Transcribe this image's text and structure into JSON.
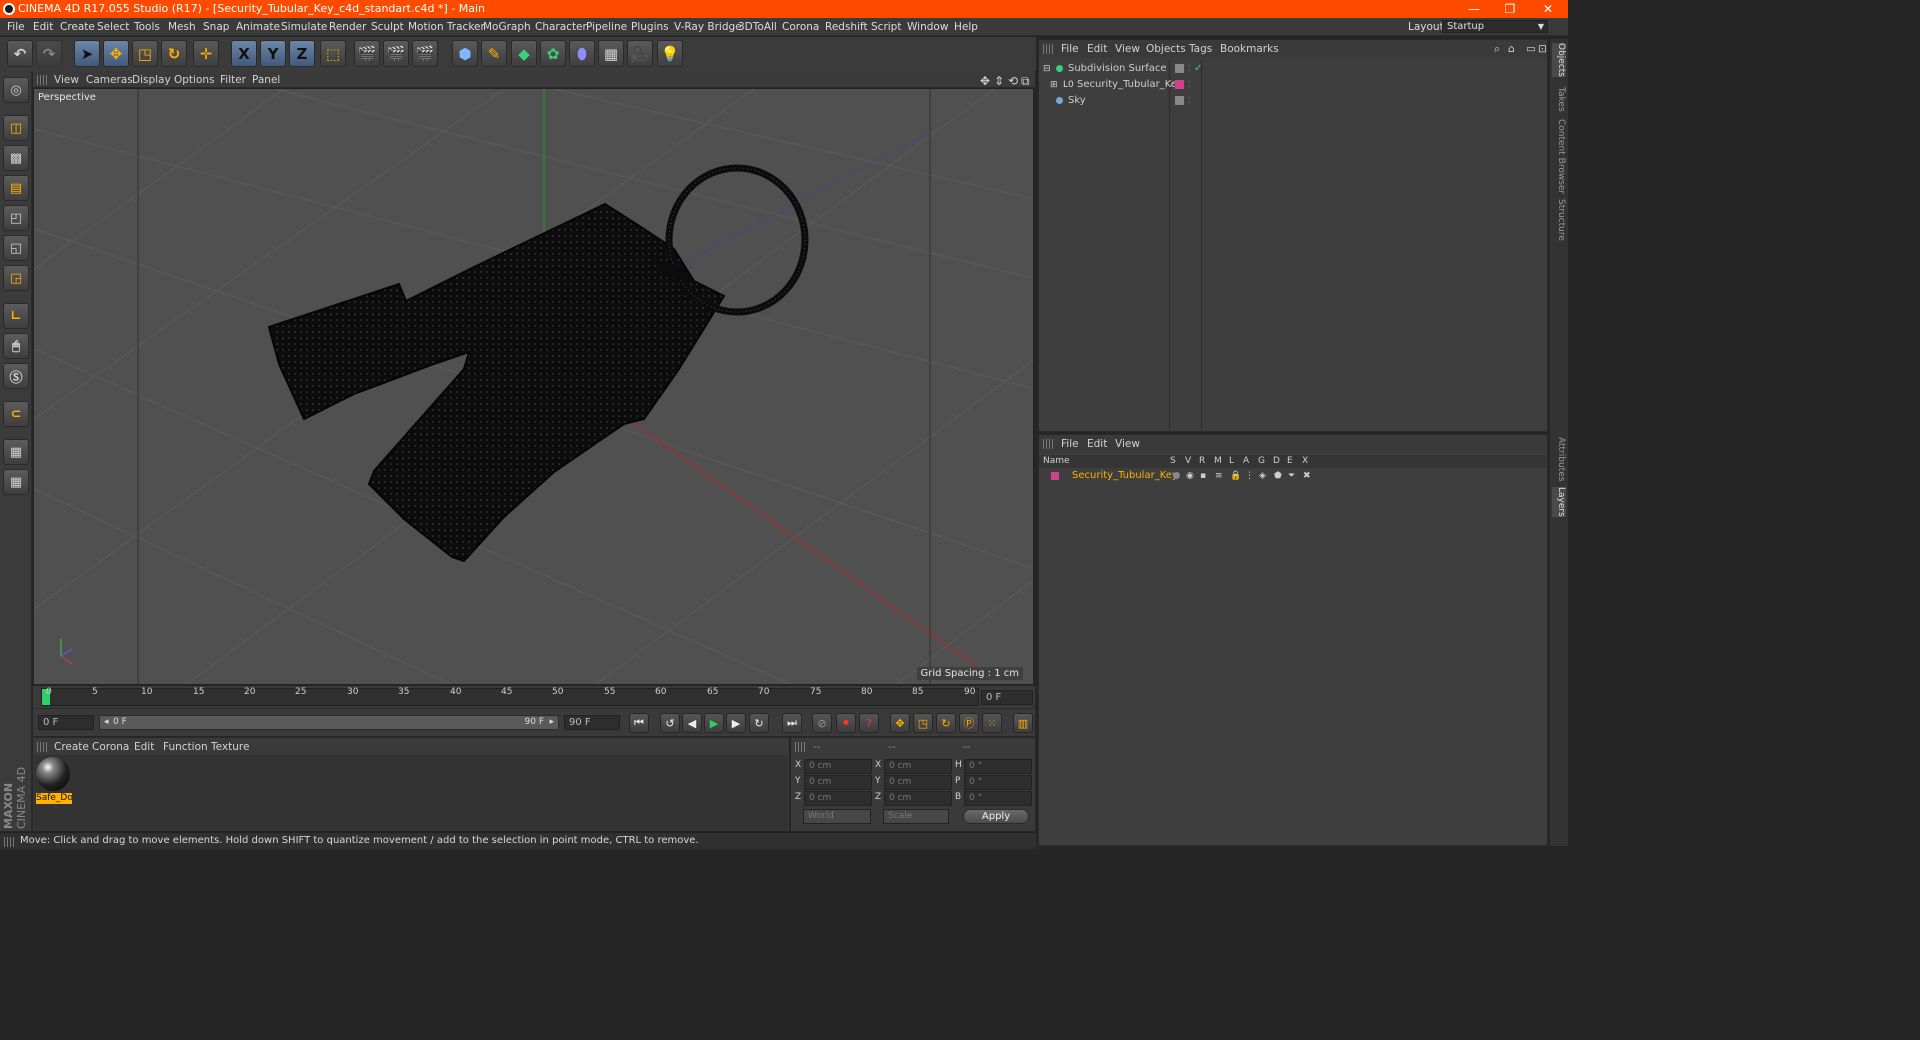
{
  "window": {
    "title": "CINEMA 4D R17.055 Studio (R17) - [Security_Tubular_Key_c4d_standart.c4d *] - Main",
    "minimize": "—",
    "restore": "❐",
    "close": "✕"
  },
  "menubar": {
    "items": [
      "File",
      "Edit",
      "Create",
      "Select",
      "Tools",
      "Mesh",
      "Snap",
      "Animate",
      "Simulate",
      "Render",
      "Sculpt",
      "Motion Tracker",
      "MoGraph",
      "Character",
      "Pipeline",
      "Plugins",
      "V-Ray Bridge",
      "3DToAll",
      "Corona",
      "Redshift",
      "Script",
      "Window",
      "Help"
    ],
    "layout_label": "Layout:",
    "layout_value": "Startup"
  },
  "toolbar": {
    "x_axis": "X",
    "y_axis": "Y",
    "z_axis": "Z"
  },
  "viewport": {
    "menu": [
      "View",
      "Cameras",
      "Display",
      "Options",
      "Filter",
      "Panel"
    ],
    "label": "Perspective",
    "grid_spacing": "Grid Spacing : 1 cm"
  },
  "timeline": {
    "ticks": [
      "0",
      "5",
      "10",
      "15",
      "20",
      "25",
      "30",
      "35",
      "40",
      "45",
      "50",
      "55",
      "60",
      "65",
      "70",
      "75",
      "80",
      "85",
      "90"
    ],
    "current_frame": "0 F"
  },
  "transport": {
    "start": "0 F",
    "range_start": "0 F",
    "range_end": "90 F",
    "end": "90 F"
  },
  "material_manager": {
    "menu": [
      "Create",
      "Corona",
      "Edit",
      "Function",
      "Texture"
    ],
    "material_name": "Safe_Do"
  },
  "coordinates": {
    "header": [
      "--",
      "--",
      "--"
    ],
    "rows": [
      {
        "a": "X",
        "av": "0 cm",
        "b": "X",
        "bv": "0 cm",
        "c": "H",
        "cv": "0 °"
      },
      {
        "a": "Y",
        "av": "0 cm",
        "b": "Y",
        "bv": "0 cm",
        "c": "P",
        "cv": "0 °"
      },
      {
        "a": "Z",
        "av": "0 cm",
        "b": "Z",
        "bv": "0 cm",
        "c": "B",
        "cv": "0 °"
      }
    ],
    "world": "World",
    "scale": "Scale",
    "apply": "Apply"
  },
  "object_manager": {
    "menu": [
      "File",
      "Edit",
      "View",
      "Objects",
      "Tags",
      "Bookmarks"
    ],
    "objects": [
      "Subdivision Surface",
      "Security_Tubular_Key",
      "Sky"
    ]
  },
  "layer_manager": {
    "menu": [
      "File",
      "Edit",
      "View"
    ],
    "col_name": "Name",
    "cols": [
      "S",
      "V",
      "R",
      "M",
      "L",
      "A",
      "G",
      "D",
      "E",
      "X"
    ],
    "layer_name": "Security_Tubular_Key"
  },
  "side_tabs": [
    "Objects",
    "Takes",
    "Content Browser",
    "Structure",
    "Attributes",
    "Layers"
  ],
  "brand": {
    "line1": "MAXON",
    "line2": "CINEMA 4D"
  },
  "status": "Move: Click and drag to move elements. Hold down SHIFT to quantize movement / add to the selection in point mode, CTRL to remove.",
  "colors": {
    "accent": "#ff4b00",
    "key_tag": "#d0408e",
    "selected_text": "#ffb000"
  }
}
